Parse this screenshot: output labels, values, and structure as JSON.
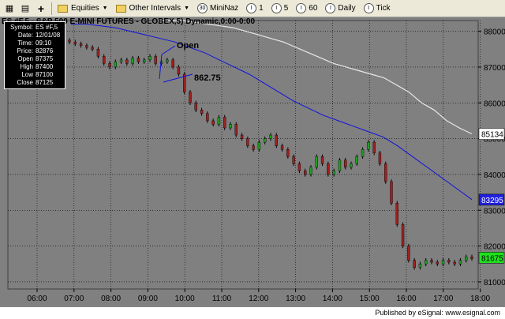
{
  "toolbar": {
    "equities_label": "Equities",
    "other_intervals_label": "Other Intervals",
    "intervals": [
      {
        "icon": "30",
        "label": "MiniNaz"
      },
      {
        "icon": "I",
        "label": "1"
      },
      {
        "icon": "I",
        "label": "5"
      },
      {
        "icon": "I",
        "label": "60"
      },
      {
        "icon": "I",
        "label": "Daily"
      },
      {
        "icon": "I",
        "label": "Tick"
      }
    ]
  },
  "chart": {
    "title": "ES #F,5 - S&P 500 E-MINI FUTURES - GLOBEX,5) Dynamic,0:00-0:00",
    "annotation_open": "Open",
    "annotation_low": "862.75",
    "price_label_white": "85134",
    "price_label_blue": "83295",
    "price_label_green": "81675",
    "colors": {
      "background": "#808080",
      "white_ma": "#e8e8e8",
      "blue_ma": "#1010e0",
      "label_blue": "#2020e0",
      "label_green": "#20e020"
    }
  },
  "info": [
    {
      "key": "Symbol:",
      "value": "ES #F,5"
    },
    {
      "key": "Date:",
      "value": "12/01/08"
    },
    {
      "key": "Time:",
      "value": "09:10"
    },
    {
      "key": "Price:",
      "value": "82876"
    },
    {
      "key": "Open",
      "value": "87375"
    },
    {
      "key": "High",
      "value": "87400"
    },
    {
      "key": "Low",
      "value": "87100"
    },
    {
      "key": "Close",
      "value": "87125"
    }
  ],
  "chart_data": {
    "type": "line",
    "x_ticks": [
      "06:00",
      "07:00",
      "08:00",
      "09:00",
      "10:00",
      "11:00",
      "12:00",
      "13:00",
      "14:00",
      "15:00",
      "16:00",
      "17:00",
      "18:00"
    ],
    "y_ticks": [
      88000,
      87000,
      86000,
      85000,
      84000,
      83000,
      82000,
      81000
    ],
    "ylim": [
      80800,
      88300
    ],
    "series": [
      {
        "values_kind": "price",
        "closes": [
          87700,
          87650,
          87600,
          87550,
          87500,
          87300,
          87100,
          87000,
          87150,
          87200,
          87100,
          87250,
          87150,
          87200,
          87300,
          87100,
          87150,
          87200,
          87000,
          86800,
          86300,
          86000,
          85800,
          85700,
          85500,
          85400,
          85600,
          85300,
          85400,
          85100,
          85000,
          84800,
          84700,
          84900,
          85000,
          85100,
          84800,
          84700,
          84500,
          84300,
          84100,
          84000,
          84200,
          84500,
          84300,
          84000,
          84100,
          84400,
          84200,
          84300,
          84500,
          84700,
          84900,
          84600,
          84300,
          83800,
          83200,
          82600,
          82000,
          81600,
          81400,
          81500,
          81600,
          81550,
          81500,
          81600,
          81550,
          81500,
          81600,
          81700,
          81650
        ]
      },
      {
        "values_kind": "ma_fast",
        "values": [
          88200,
          88200,
          88150,
          88100,
          88000,
          87900,
          87800,
          87700,
          87550,
          87400,
          87200,
          87000,
          86800,
          86550,
          86300,
          86050,
          85850,
          85650,
          85500,
          85350,
          85200,
          85050,
          84800,
          84500,
          84200,
          83900,
          83600,
          83300
        ]
      },
      {
        "values_kind": "ma_slow",
        "values": [
          88300,
          88300,
          88300,
          88250,
          88200,
          88150,
          88100,
          88000,
          87900,
          87800,
          87700,
          87550,
          87400,
          87250,
          87100,
          87000,
          86900,
          86800,
          86700,
          86500,
          86300,
          86000,
          85800,
          85500,
          85300,
          85134
        ]
      }
    ]
  },
  "footer": {
    "text": "Published by eSignal: www.esignal.com"
  }
}
